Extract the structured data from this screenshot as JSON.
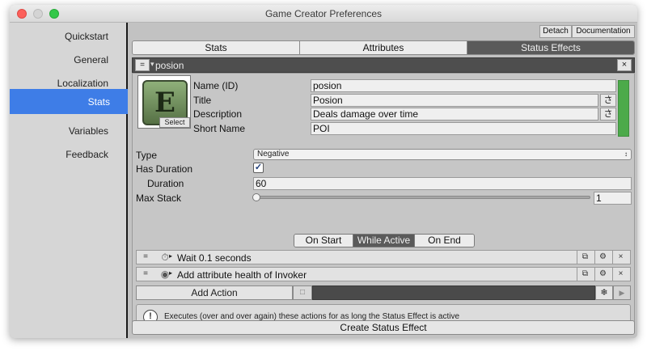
{
  "window": {
    "title": "Game Creator Preferences"
  },
  "sidebar": {
    "items": [
      {
        "label": "Quickstart"
      },
      {
        "label": "General"
      },
      {
        "label": "Localization"
      },
      {
        "label": "Stats"
      },
      {
        "label": "Variables"
      },
      {
        "label": "Feedback"
      }
    ],
    "active": "Stats"
  },
  "toolbar": {
    "detach_label": "Detach",
    "documentation_label": "Documentation"
  },
  "tabs": [
    {
      "label": "Stats"
    },
    {
      "label": "Attributes"
    },
    {
      "label": "Status Effects"
    }
  ],
  "active_tab": "Status Effects",
  "status_effect": {
    "header_title": "posion",
    "select_label": "Select",
    "icon_letter": "E",
    "labels": {
      "name": "Name (ID)",
      "title": "Title",
      "description": "Description",
      "short_name": "Short Name",
      "type": "Type",
      "has_duration": "Has Duration",
      "duration": "Duration",
      "max_stack": "Max Stack"
    },
    "values": {
      "name": "posion",
      "title": "Posion",
      "description": "Deals damage over time",
      "short_name": "POI",
      "type": "Negative",
      "has_duration": true,
      "duration": "60",
      "max_stack": "1"
    },
    "color": "#4caa4a"
  },
  "action_tabs": [
    {
      "label": "On Start"
    },
    {
      "label": "While Active"
    },
    {
      "label": "On End"
    }
  ],
  "active_action_tab": "While Active",
  "actions": [
    {
      "label": "Wait 0.1 seconds",
      "icon": "stopwatch-icon"
    },
    {
      "label": "Add attribute health of Invoker",
      "icon": "attribute-icon"
    }
  ],
  "add_action_label": "Add Action",
  "info_text": "Executes (over and over again) these actions for as long the Status Effect is active",
  "create_button_label": "Create Status Effect"
}
